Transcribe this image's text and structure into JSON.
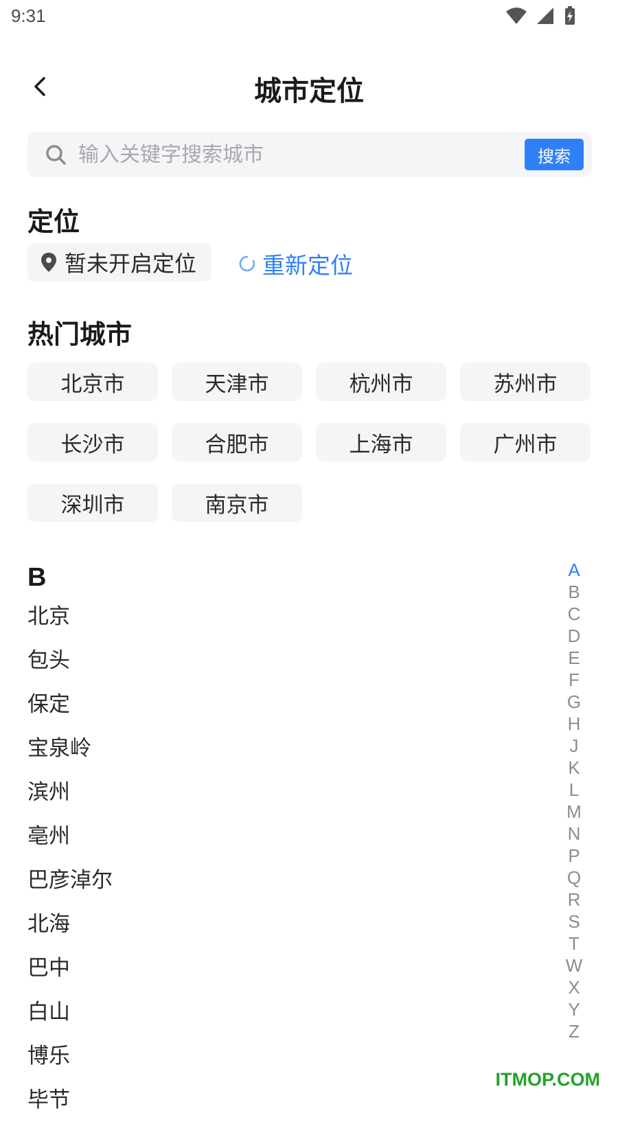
{
  "status": {
    "time": "9:31"
  },
  "header": {
    "title": "城市定位"
  },
  "search": {
    "placeholder": "输入关键字搜索城市",
    "button_label": "搜索"
  },
  "location": {
    "section_title": "定位",
    "status_text": "暂未开启定位",
    "relocate_label": "重新定位"
  },
  "hot": {
    "section_title": "热门城市",
    "cities": [
      "北京市",
      "天津市",
      "杭州市",
      "苏州市",
      "长沙市",
      "合肥市",
      "上海市",
      "广州市",
      "深圳市",
      "南京市"
    ]
  },
  "list": {
    "group_letter": "B",
    "cities": [
      "北京",
      "包头",
      "保定",
      "宝泉岭",
      "滨州",
      "亳州",
      "巴彦淖尔",
      "北海",
      "巴中",
      "白山",
      "博乐",
      "毕节"
    ]
  },
  "alphabet": {
    "letters": [
      "A",
      "B",
      "C",
      "D",
      "E",
      "F",
      "G",
      "H",
      "J",
      "K",
      "L",
      "M",
      "N",
      "P",
      "Q",
      "R",
      "S",
      "T",
      "W",
      "X",
      "Y",
      "Z"
    ],
    "active": "A"
  },
  "colors": {
    "accent": "#2f80f8",
    "chip_bg": "#f4f5f7"
  },
  "watermark": "ITMOP.COM"
}
